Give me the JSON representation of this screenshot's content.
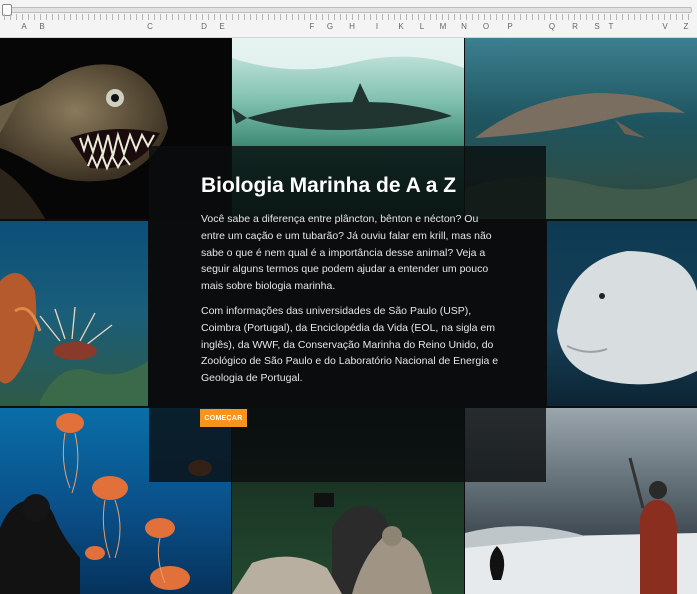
{
  "navigation": {
    "letters": [
      "A",
      "B",
      "C",
      "D",
      "E",
      "F",
      "G",
      "H",
      "I",
      "K",
      "L",
      "M",
      "N",
      "O",
      "P",
      "Q",
      "R",
      "S",
      "T",
      "V",
      "Z"
    ]
  },
  "overlay": {
    "title": "Biologia Marinha de A a Z",
    "paragraph1": "Você sabe a diferença entre plâncton, bênton e nécton? Ou entre um cação e um tubarão? Já ouviu falar em krill, mas não sabe o que é nem qual é a importância desse animal? Veja a seguir alguns termos que podem ajudar a entender um pouco mais sobre biologia marinha.",
    "paragraph2": "Com informações das universidades de São Paulo (USP), Coimbra (Portugal), da Enciclopédia da Vida (EOL, na sigla em inglês), da WWF, da Conservação Marinha do Reino Unido, do Zoológico de São Paulo e do Laboratório Nacional de Energia e Geologia de Portugal.",
    "start_button": "COMEÇAR"
  },
  "colors": {
    "accent": "#f7941e"
  }
}
